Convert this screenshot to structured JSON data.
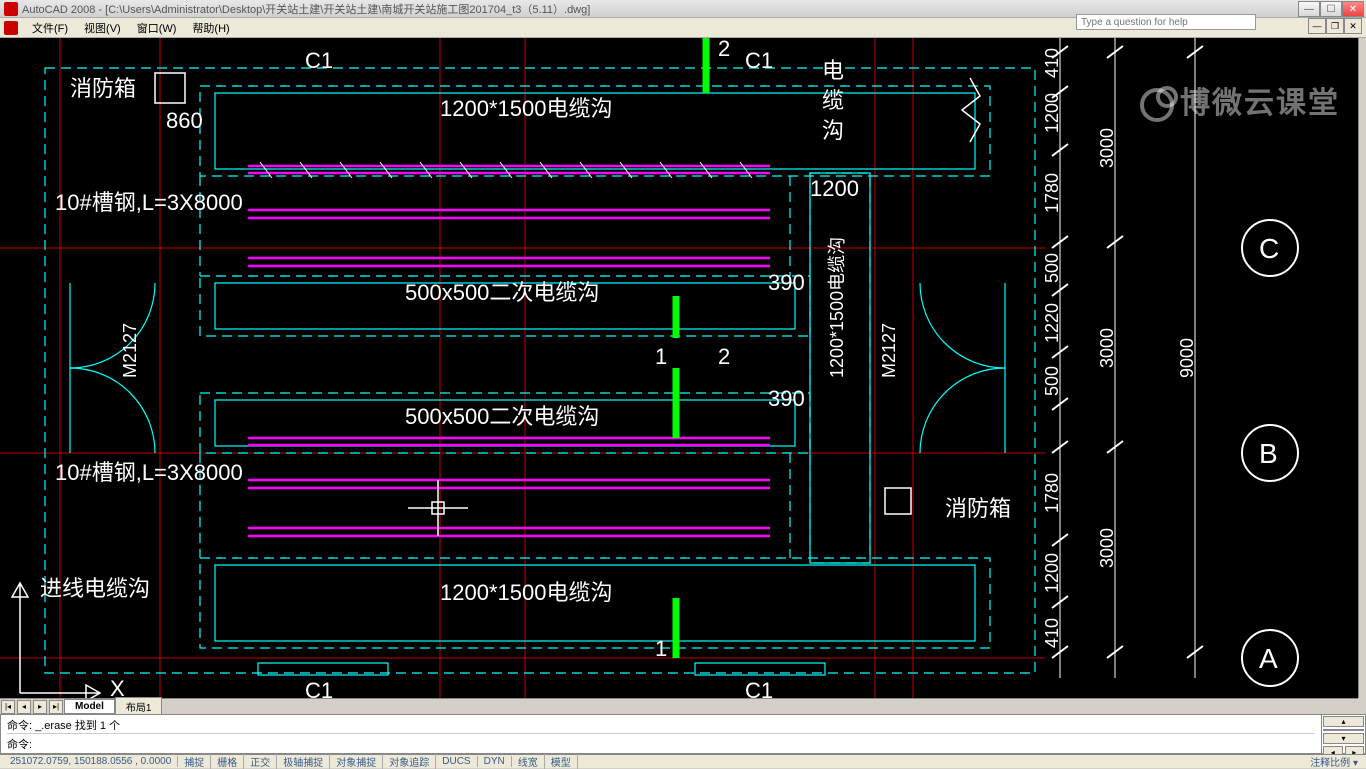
{
  "title": "AutoCAD 2008 - [C:\\Users\\Administrator\\Desktop\\开关站土建\\开关站土建\\南城开关站施工图201704_t3（5.11）.dwg]",
  "menu": {
    "file": "文件(F)",
    "view": "视图(V)",
    "window": "窗口(W)",
    "help": "帮助(H)"
  },
  "help_placeholder": "Type a question for help",
  "tabs": {
    "model": "Model",
    "layout1": "布局1"
  },
  "cmd": {
    "history": "命令: _.erase 找到 1 个",
    "prompt": "命令:",
    "input": ""
  },
  "status": {
    "coords": "251072.0759, 150188.0556 , 0.0000",
    "snap": "捕捉",
    "grid": "栅格",
    "ortho": "正交",
    "polar": "极轴捕捉",
    "osnap": "对象捕捉",
    "otrack": "对象追踪",
    "ducs": "DUCS",
    "dyn": "DYN",
    "lwt": "线宽",
    "model": "模型",
    "right": "注释比例 ▾"
  },
  "watermark": "博微云课堂",
  "drawing": {
    "labels": {
      "xfx1": "消防箱",
      "xfx2": "消防箱",
      "c1_tl": "C1",
      "c1_tr": "C1",
      "c1_bl": "C1",
      "c1_br": "C1",
      "cable_top": "1200*1500电缆沟",
      "cable_bot": "1200*1500电缆沟",
      "sec_top": "500x500二次电缆沟",
      "sec_bot": "500x500二次电缆沟",
      "channel1": "10#槽钢,L=3X8000",
      "channel2": "10#槽钢,L=3X8000",
      "jxdl": "进线电缆沟",
      "dlg_v": "电缆沟",
      "num2_t": "2",
      "num1": "1",
      "num2": "2",
      "num1_b": "1",
      "d860": "860",
      "d1200": "1200",
      "d390a": "390",
      "d390b": "390",
      "m2127a": "M2127",
      "m2127b": "M2127",
      "r410a": "410",
      "r1200a": "1200",
      "r1780a": "1780",
      "r500a": "500",
      "r1220": "1220",
      "r500b": "500",
      "r1780b": "1780",
      "r1200b": "1200",
      "r410b": "410",
      "r3000a": "3000",
      "r3000b": "3000",
      "r3000c": "3000",
      "r9000": "9000",
      "axisA": "A",
      "axisB": "B",
      "axisC": "C",
      "axisX": "X",
      "dim1200x1500": "1200*1500电缆沟"
    }
  }
}
